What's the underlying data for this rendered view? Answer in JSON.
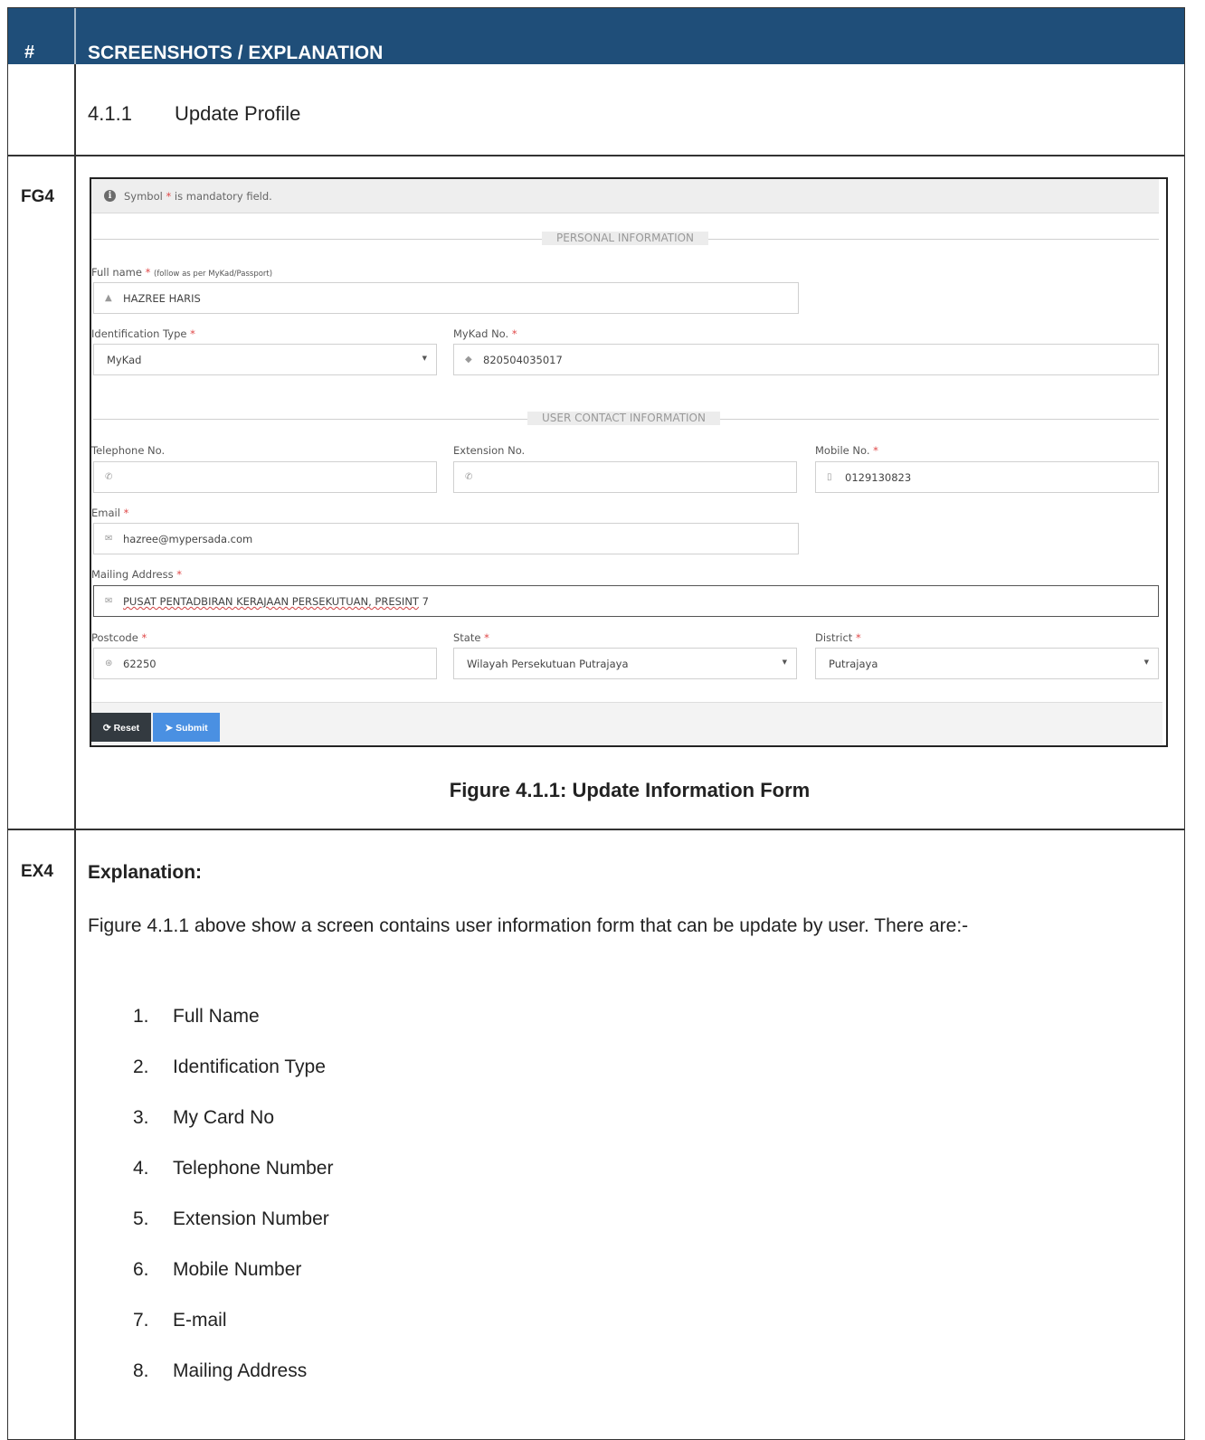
{
  "header": {
    "num_col": "#",
    "title_col": "SCREENSHOTS / EXPLANATION"
  },
  "section": {
    "number": "4.1.1",
    "title": "Update Profile"
  },
  "rows": {
    "figure_label": "FG4",
    "explanation_label": "EX4"
  },
  "form": {
    "notice_prefix": "Symbol",
    "notice_star": "*",
    "notice_suffix": "is mandatory field.",
    "personal_section": "PERSONAL INFORMATION",
    "contact_section": "USER CONTACT INFORMATION",
    "required_mark": "*",
    "full_name_label": "Full name",
    "full_name_hint": "(follow as per MyKad/Passport)",
    "full_name_value": "HAZREE HARIS",
    "id_type_label": "Identification Type",
    "id_type_value": "MyKad",
    "mykad_label": "MyKad No.",
    "mykad_value": "820504035017",
    "telephone_label": "Telephone No.",
    "telephone_value": "",
    "extension_label": "Extension No.",
    "extension_value": "",
    "mobile_label": "Mobile No.",
    "mobile_value": "0129130823",
    "email_label": "Email",
    "email_value": "hazree@mypersada.com",
    "mailing_label": "Mailing Address",
    "mailing_value_underlined": "PUSAT PENTADBIRAN KERAJAAN PERSEKUTUAN, PRESINT",
    "mailing_value_tail": " 7",
    "postcode_label": "Postcode",
    "postcode_value": "62250",
    "state_label": "State",
    "state_value": "Wilayah Persekutuan Putrajaya",
    "district_label": "District",
    "district_value": "Putrajaya",
    "reset_label": "Reset",
    "submit_label": "Submit"
  },
  "caption": "Figure 4.1.1: Update Information Form",
  "explanation": {
    "heading": "Explanation:",
    "paragraph": "Figure 4.1.1 above show a screen contains user information form that can be update by user. There are:-",
    "items": [
      {
        "no": "1.",
        "text": "Full Name"
      },
      {
        "no": "2.",
        "text": "Identification Type"
      },
      {
        "no": "3.",
        "text": "My Card No"
      },
      {
        "no": "4.",
        "text": "Telephone Number"
      },
      {
        "no": "5.",
        "text": "Extension Number"
      },
      {
        "no": "6.",
        "text": "Mobile Number"
      },
      {
        "no": "7.",
        "text": "E-mail"
      },
      {
        "no": "8.",
        "text": "Mailing Address"
      }
    ]
  }
}
